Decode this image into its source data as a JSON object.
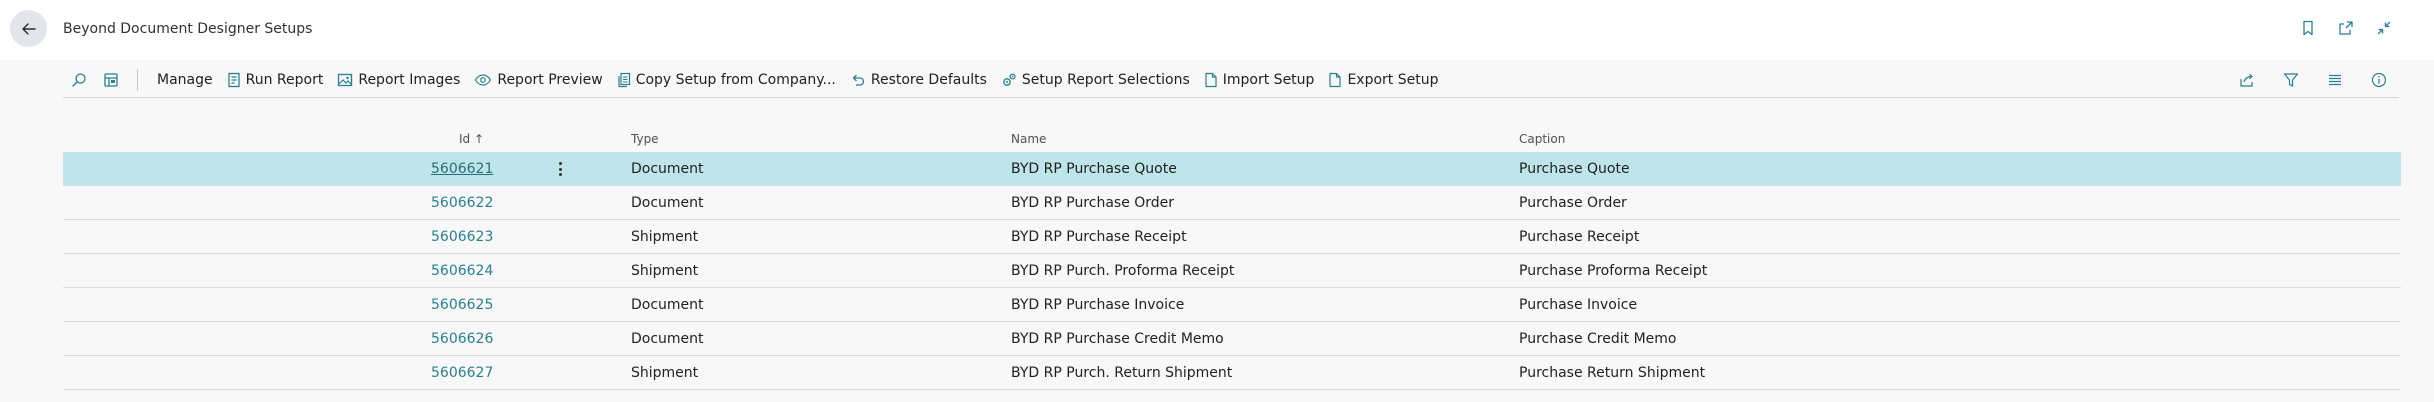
{
  "page": {
    "title": "Beyond Document Designer Setups",
    "back_icon": "arrow-left-icon",
    "title_actions": [
      {
        "icon": "bookmark-icon"
      },
      {
        "icon": "open-new-window-icon"
      },
      {
        "icon": "collapse-icon"
      }
    ]
  },
  "toolbar": {
    "search_icon": "search-icon",
    "layout_icon": "filter-pane-icon",
    "manage": "Manage",
    "run_report": "Run Report",
    "report_images": "Report Images",
    "report_preview": "Report Preview",
    "copy_setup": "Copy Setup from Company...",
    "restore_defaults": "Restore Defaults",
    "setup_report_selections": "Setup Report Selections",
    "import_setup": "Import Setup",
    "export_setup": "Export Setup",
    "right_icons": [
      "share-icon",
      "filter-icon",
      "list-view-icon",
      "info-icon"
    ]
  },
  "table": {
    "columns": {
      "id": "Id ↑",
      "type": "Type",
      "name": "Name",
      "caption": "Caption"
    },
    "rows": [
      {
        "id": "5606621",
        "type": "Document",
        "name": "BYD RP Purchase Quote",
        "caption": "Purchase Quote"
      },
      {
        "id": "5606622",
        "type": "Document",
        "name": "BYD RP Purchase Order",
        "caption": "Purchase Order"
      },
      {
        "id": "5606623",
        "type": "Shipment",
        "name": "BYD RP Purchase Receipt",
        "caption": "Purchase Receipt"
      },
      {
        "id": "5606624",
        "type": "Shipment",
        "name": "BYD RP Purch. Proforma Receipt",
        "caption": "Purchase Proforma Receipt"
      },
      {
        "id": "5606625",
        "type": "Document",
        "name": "BYD RP Purchase Invoice",
        "caption": "Purchase Invoice"
      },
      {
        "id": "5606626",
        "type": "Document",
        "name": "BYD RP Purchase Credit Memo",
        "caption": "Purchase Credit Memo"
      },
      {
        "id": "5606627",
        "type": "Shipment",
        "name": "BYD RP Purch. Return Shipment",
        "caption": "Purchase Return Shipment"
      }
    ],
    "selected_row": 0,
    "row_menu_icon": "more-vertical-icon"
  }
}
